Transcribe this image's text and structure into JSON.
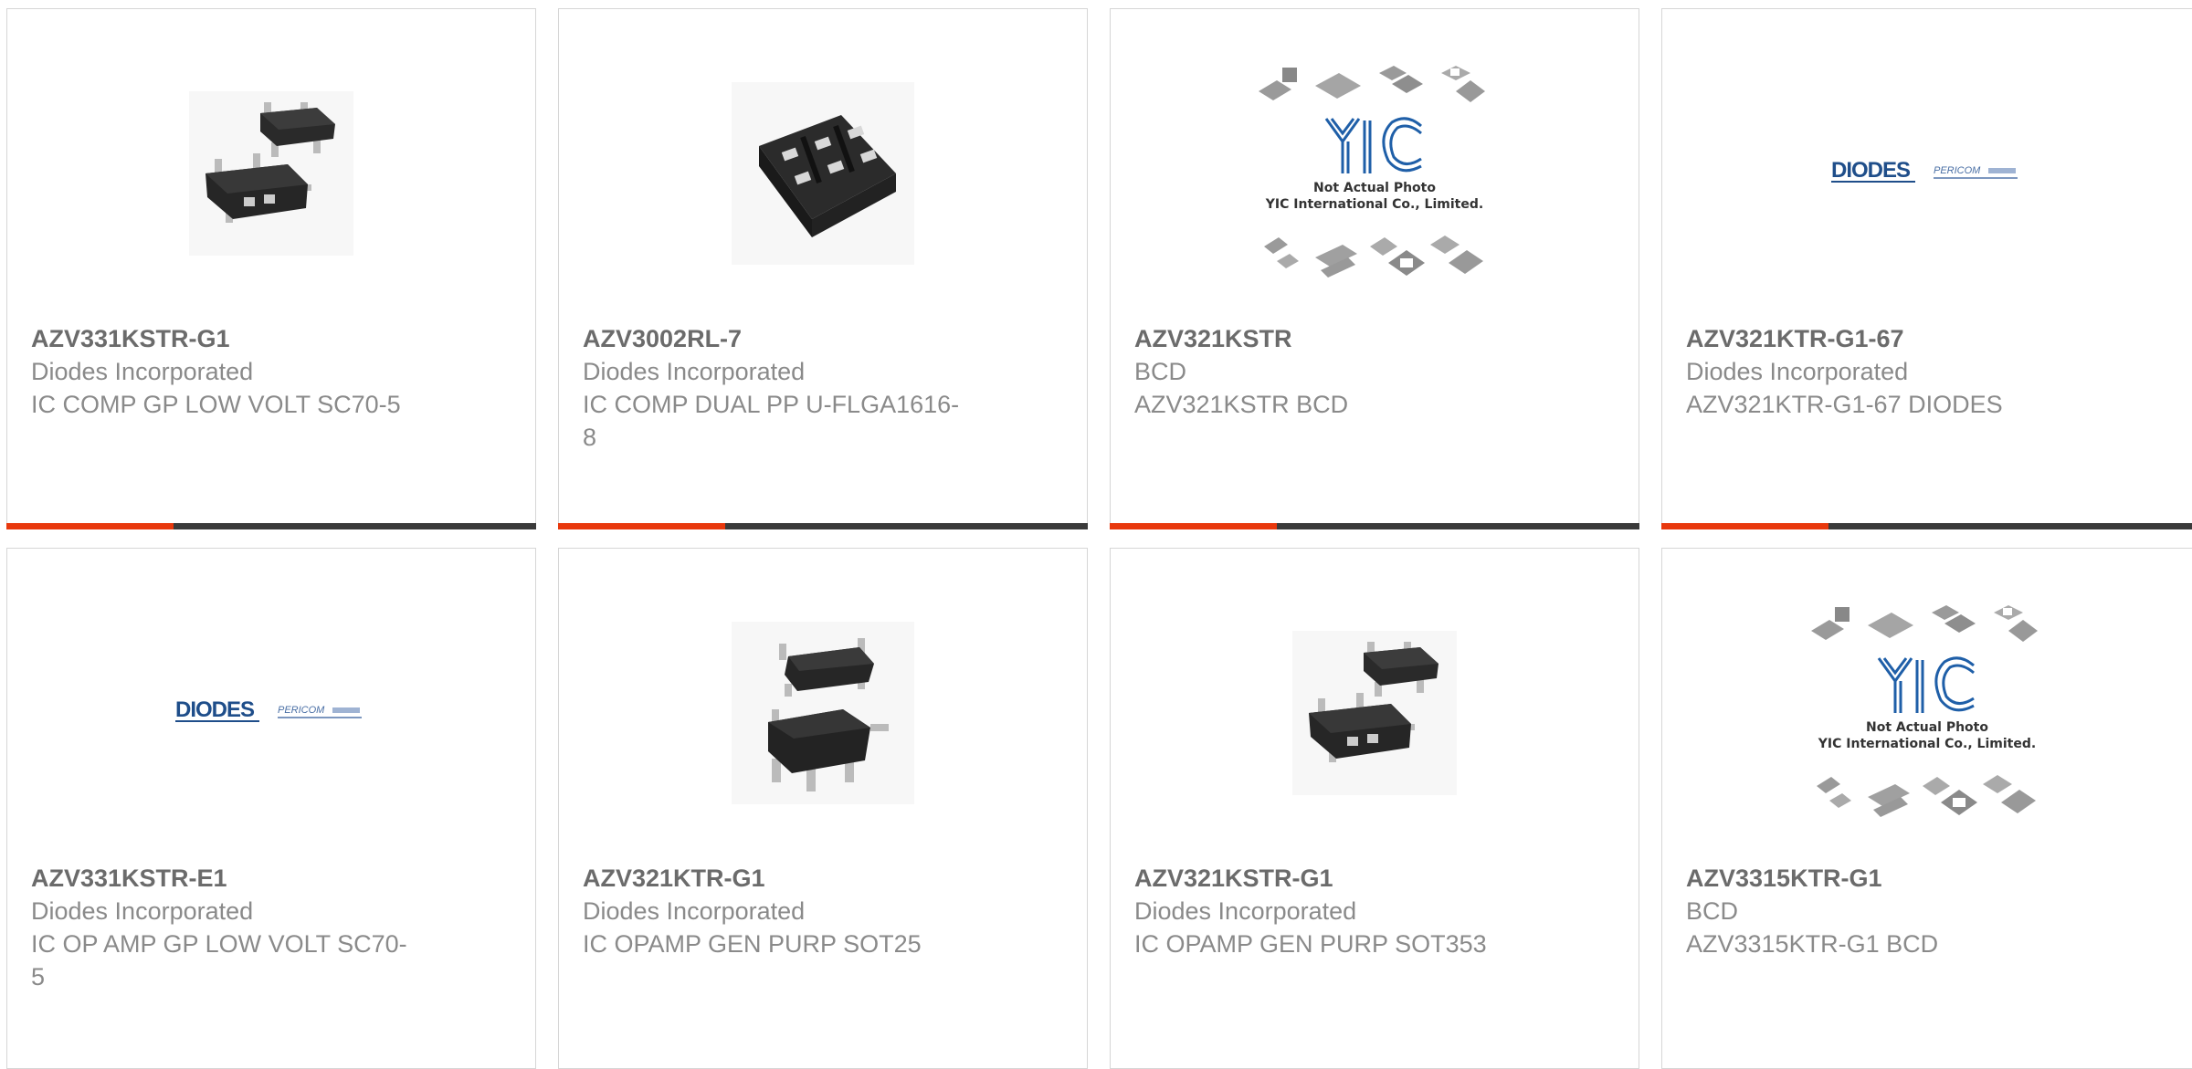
{
  "products": [
    {
      "part_number": "AZV331KSTR-G1",
      "manufacturer": "Diodes Incorporated",
      "description": "IC COMP GP LOW VOLT SC70-5",
      "image": "sot353-package-icon"
    },
    {
      "part_number": "AZV3002RL-7",
      "manufacturer": "Diodes Incorporated",
      "description": "IC COMP DUAL PP U-FLGA1616-8",
      "image": "flga-package-icon"
    },
    {
      "part_number": "AZV321KSTR",
      "manufacturer": "BCD",
      "description": "AZV321KSTR BCD",
      "image": "yic-placeholder-image",
      "placeholder_line1": "Not Actual Photo",
      "placeholder_line2": "YIC International Co., Limited."
    },
    {
      "part_number": "AZV321KTR-G1-67",
      "manufacturer": "Diodes Incorporated",
      "description": "AZV321KTR-G1-67 DIODES",
      "image": "diodes-pericom-logo"
    },
    {
      "part_number": "AZV331KSTR-E1",
      "manufacturer": "Diodes Incorporated",
      "description": "IC OP AMP GP LOW VOLT SC70-5",
      "image": "diodes-pericom-logo"
    },
    {
      "part_number": "AZV321KTR-G1",
      "manufacturer": "Diodes Incorporated",
      "description": "IC OPAMP GEN PURP SOT25",
      "image": "sot25-package-icon"
    },
    {
      "part_number": "AZV321KSTR-G1",
      "manufacturer": "Diodes Incorporated",
      "description": "IC OPAMP GEN PURP SOT353",
      "image": "sot353-package-icon"
    },
    {
      "part_number": "AZV3315KTR-G1",
      "manufacturer": "BCD",
      "description": "AZV3315KTR-G1 BCD",
      "image": "yic-placeholder-image",
      "placeholder_line1": "Not Actual Photo",
      "placeholder_line2": "YIC International Co., Limited."
    }
  ],
  "logo_text": {
    "brand": "DIODES",
    "sub": "PERICOM"
  },
  "colors": {
    "accent": "#e8380d",
    "bar": "#3a3a3a",
    "border": "#d6d6d6",
    "text": "#8a8a8a"
  }
}
